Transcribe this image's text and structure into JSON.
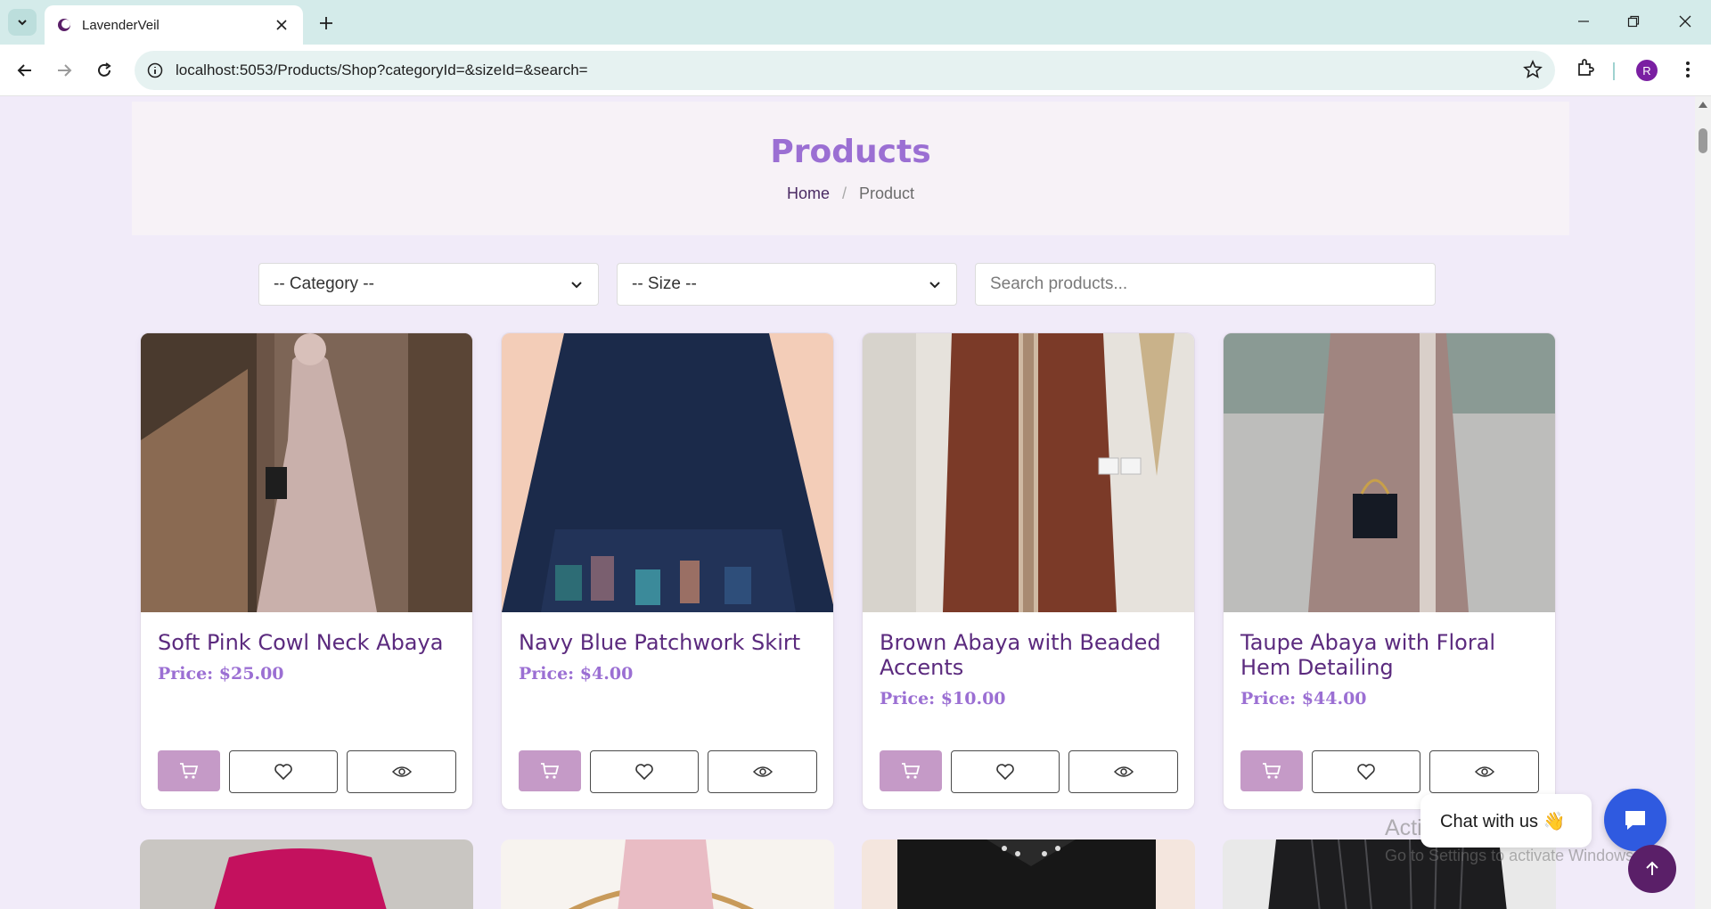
{
  "browser": {
    "tab_title": "LavenderVeil",
    "url": "localhost:5053/Products/Shop?categoryId=&sizeId=&search=",
    "profile_initial": "R"
  },
  "page": {
    "title": "Products",
    "breadcrumb": {
      "home": "Home",
      "separator": "/",
      "current": "Product"
    }
  },
  "filters": {
    "category": "-- Category --",
    "size": "-- Size --",
    "search_placeholder": "Search products..."
  },
  "products": [
    {
      "name": "Soft Pink Cowl Neck Abaya",
      "price": "Price: $25.00"
    },
    {
      "name": "Navy Blue Patchwork Skirt",
      "price": "Price: $4.00"
    },
    {
      "name": "Brown Abaya with Beaded Accents",
      "price": "Price: $10.00"
    },
    {
      "name": "Taupe Abaya with Floral Hem Detailing",
      "price": "Price: $44.00"
    }
  ],
  "chat": {
    "label": "Chat with us 👋"
  },
  "watermark": {
    "line1": "Activate Windows",
    "line2": "Go to Settings to activate Windows."
  },
  "colors": {
    "accent": "#9b6fd3",
    "product_name": "#5b2a7e",
    "cart_button": "#c59ac7",
    "chat_button": "#2f5ae0",
    "back_to_top": "#5a1f68"
  }
}
